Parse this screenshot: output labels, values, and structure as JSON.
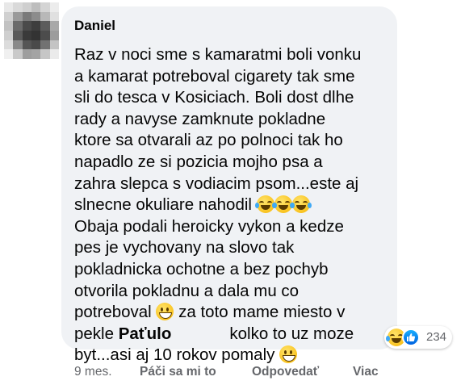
{
  "comment": {
    "author": "Daniel",
    "lines": [
      "Raz v noci sme s kamaratmi boli vonku",
      "a kamarat potreboval cigarety tak sme",
      "sli do tesca v Kosiciach. Boli dost dlhe",
      "rady a navyse zamknute pokladne",
      "ktore sa otvarali az po polnoci tak ho",
      "napadlo ze si pozicia mojho psa a",
      "zahra slepca s vodiacim psom...este aj",
      "slnecne okuliare nahodil",
      "Obaja podali heroicky vykon a kedze",
      "pes je vychovany na slovo tak",
      "pokladnicka ochotne a bez pochyb",
      "otvorila pokladnu a dala mu co",
      "potreboval",
      "za toto mame miesto v",
      "pekle",
      "Paťulo",
      "kolko to uz moze",
      "byt...asi aj 10 rokov pomaly"
    ],
    "emojis": {
      "laugh": "face-with-tears-of-joy-icon",
      "grin": "grinning-face-icon"
    }
  },
  "reactions": {
    "icons": [
      "face-with-tears-of-joy-icon",
      "like-icon"
    ],
    "count": "234",
    "like_color": "#0866ff"
  },
  "actions": {
    "time": "9 mes.",
    "like": "Páči sa mi to",
    "reply": "Odpovedať",
    "more": "Viac"
  }
}
